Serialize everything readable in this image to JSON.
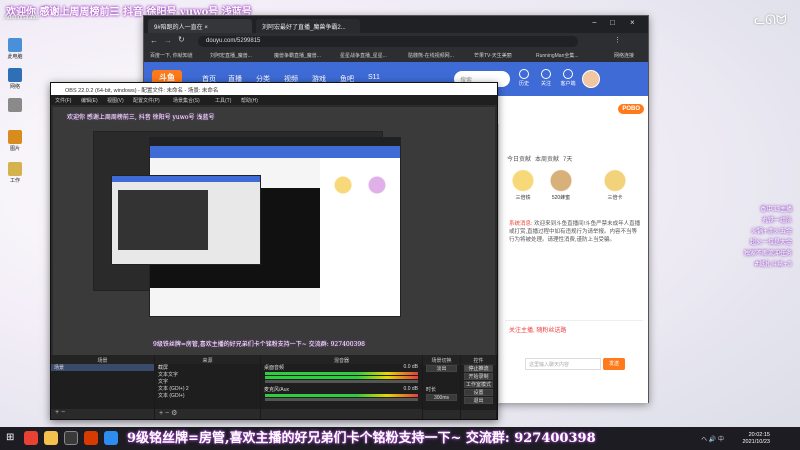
{
  "desktop": {
    "user": "Administrator",
    "banner": "欢迎你 感谢上周周榜前三 抖音 徐阳号 yuwo号 浅蓝号",
    "icons": [
      {
        "label": "此电脑",
        "color": "#4a90d9"
      },
      {
        "label": "网络",
        "color": "#2f6fb5"
      },
      {
        "label": "",
        "color": "#8a8a8a"
      },
      {
        "label": "图片",
        "color": "#d98c1e"
      },
      {
        "label": "工作",
        "color": "#d4b34e"
      }
    ],
    "side_text": [
      "香中33主播",
      "丸铁一组队",
      "火锅+赤火五金",
      "超火一位是大金",
      "独家不断流冲任务",
      "#纸扎斗丝+5"
    ]
  },
  "browser": {
    "tabs": [
      "9#陪跑的人一直在 ×",
      "刘阿宏最好了直播_魔兽争霸2..."
    ],
    "window_controls": [
      "−",
      "□",
      "×"
    ],
    "url": "douyu.com/5299815",
    "bookmarks": [
      "百度一下, 你就知道",
      "刘阿宏直播_魔兽...",
      "魔兽争霸直播_魔兽...",
      "星星战争直播_星星...",
      "骷髅熊-在线视频网...",
      "芒果TV-天生美丽",
      "RunningMan全集...",
      "网络连接"
    ],
    "site": {
      "logo": "斗鱼",
      "nav": [
        "首页",
        "直播",
        "分类",
        "视频",
        "游戏",
        "鱼吧",
        "S11"
      ],
      "search_placeholder": "搜索",
      "header_icons": [
        "历史",
        "关注",
        "客户端"
      ],
      "pobo": "POBO",
      "gift_tabs": [
        "今日贡献",
        "本周贡献",
        "7天"
      ],
      "gifts": [
        {
          "name": "三倍铁",
          "color": "#e7b74a"
        },
        {
          "name": "520蜂蜜",
          "color": "#c49a4c"
        },
        {
          "name": "三倍卡",
          "color": "#f2d27a"
        }
      ],
      "notice_title": "系统消息:",
      "notice_text": "欢迎来到斗鱼直播间!斗鱼严禁未成年人直播或打赏,直播过程中如有违规行为请举报。内容不当等行为将被处理。请理性消费,谨防上当受骗。",
      "follow_hint": "关注主播, 随粉丝送路",
      "send_placeholder": "这里输入聊天内容",
      "send_button": "发送"
    }
  },
  "obs": {
    "title": "OBS 22.0.2 (64-bit, windows) - 配置文件: 未命名 - 场景: 未命名",
    "menu": [
      "文件(F)",
      "编辑(E)",
      "视图(V)",
      "配置文件(P)",
      "场景集合(S)",
      "工具(T)",
      "帮助(H)"
    ],
    "preview_banner": "欢迎你 感谢上周周榜前三, 抖音 徐阳号 yuwo号 浅蓝号",
    "preview_bottom": "9级铁丝牌=房管,喜欢主播的好兄弟们卡个铭粉支持一下~ 交流群: 927400398",
    "docks": {
      "scenes": {
        "title": "场景",
        "items": [
          "场景"
        ]
      },
      "sources": {
        "title": "来源",
        "items": [
          "截屏",
          "文本文字",
          "文字",
          "文本 (GDI+) 2",
          "文本 (GDI+)"
        ]
      },
      "mixer": {
        "title": "混音器",
        "items": [
          "桌面音频",
          "麦克风/Aux"
        ],
        "levels": [
          "0.0 dB",
          "0.0 dB"
        ]
      },
      "transitions": {
        "title": "场景切换",
        "mode": "淡出",
        "duration_label": "时长",
        "duration": "300ms"
      },
      "controls": {
        "title": "控件",
        "buttons": [
          "停止推流",
          "开始录制",
          "工作室模式",
          "设置",
          "退出"
        ]
      }
    }
  },
  "taskbar": {
    "marquee": "9级铭丝牌=房管,喜欢主播的好兄弟们卡个铭粉支持一下~ 交流群: 927400398",
    "tray": "へ 🔊 中",
    "time": "20:02:15",
    "date": "2021/10/23",
    "apps": [
      {
        "name": "chrome-icon",
        "color": "#e94235"
      },
      {
        "name": "explorer-icon",
        "color": "#f2c14e"
      },
      {
        "name": "obs-icon",
        "color": "#3a3a3a"
      },
      {
        "name": "media-icon",
        "color": "#d83b01"
      },
      {
        "name": "app-icon",
        "color": "#2d8cf0"
      }
    ]
  }
}
